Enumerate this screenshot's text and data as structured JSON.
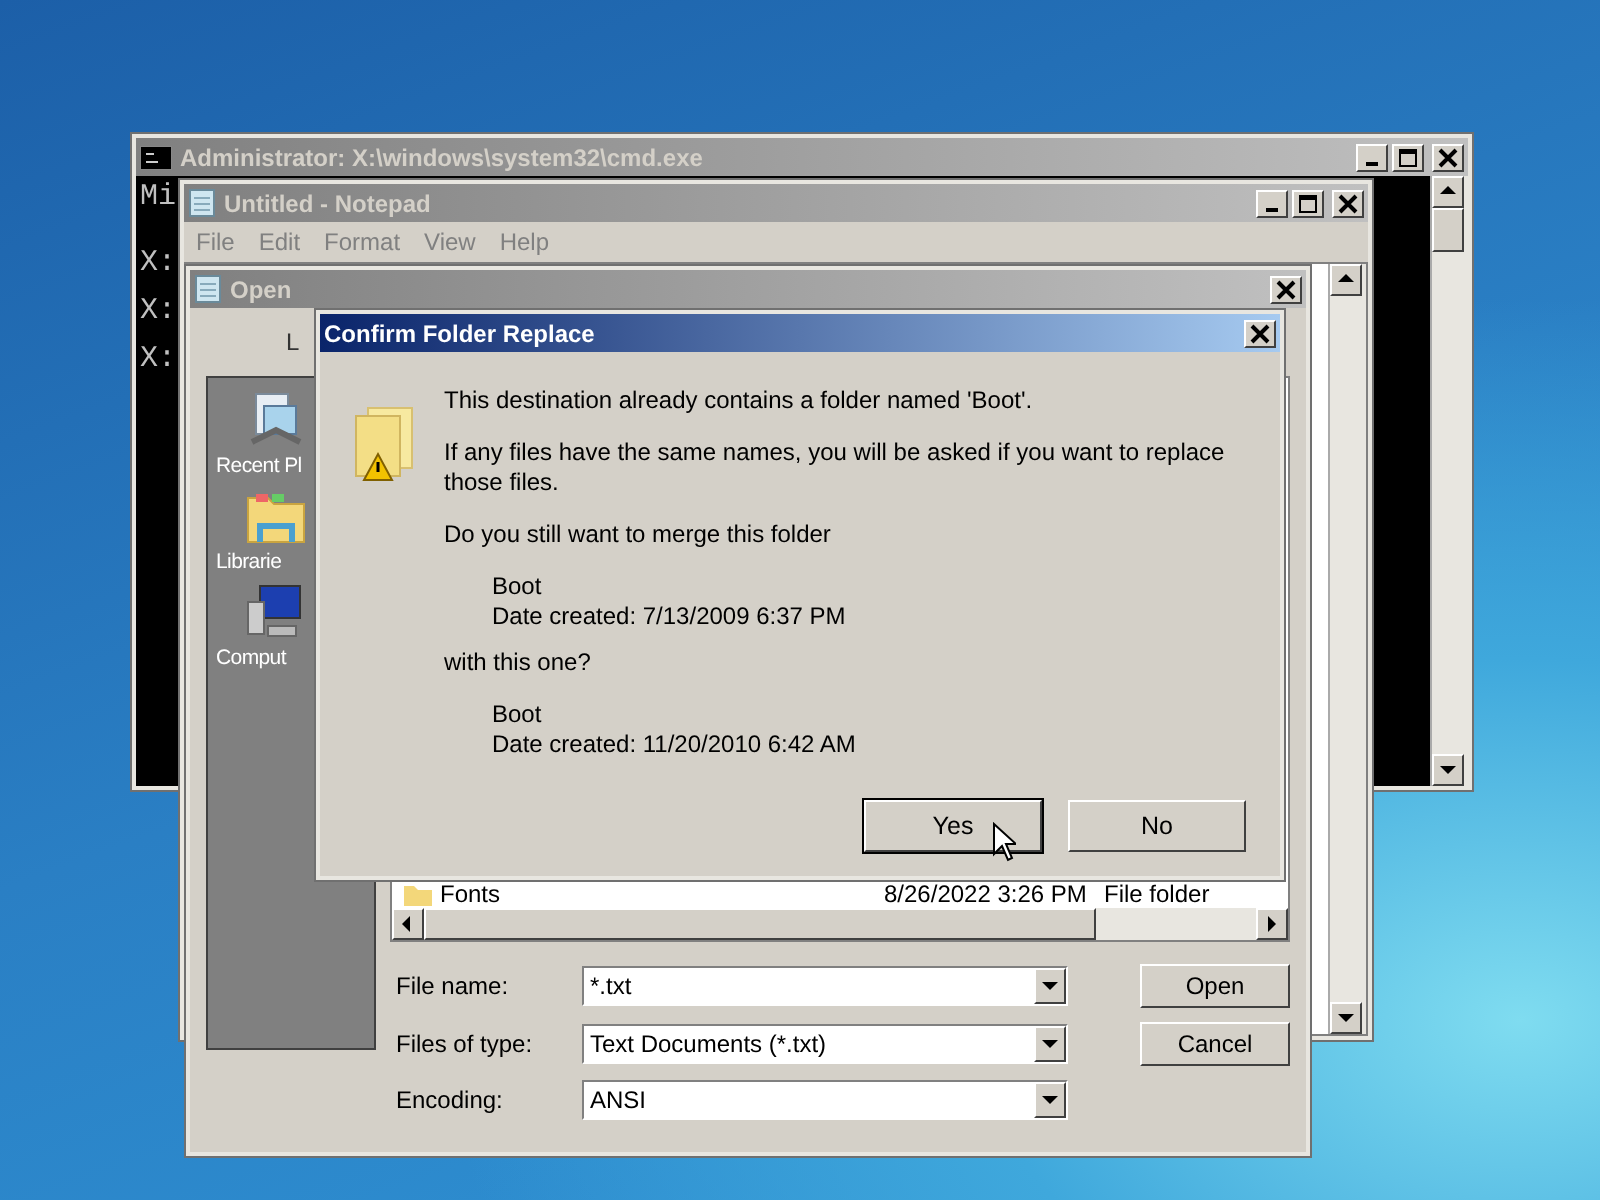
{
  "console_window": {
    "title": "Administrator: X:\\windows\\system32\\cmd.exe",
    "lines": [
      "Mi",
      "X:",
      "X:",
      "X:"
    ]
  },
  "notepad_window": {
    "title": "Untitled - Notepad",
    "menu": [
      "File",
      "Edit",
      "Format",
      "View",
      "Help"
    ]
  },
  "open_dialog": {
    "title": "Open",
    "look_in_label": "L",
    "places": [
      {
        "label": "Recent Pl",
        "kind": "recent"
      },
      {
        "label": "Librarie",
        "kind": "libraries"
      },
      {
        "label": "Comput",
        "kind": "computer"
      }
    ],
    "files": [
      {
        "name": "Fonts",
        "date_modified": "8/26/2022 3:26 PM",
        "type": "File folder"
      }
    ],
    "fields": [
      {
        "label": "File name:",
        "value": "*.txt"
      },
      {
        "label": "Files of type:",
        "value": "Text Documents (*.txt)"
      },
      {
        "label": "Encoding:",
        "value": "ANSI"
      }
    ],
    "buttons": [
      "Open",
      "Cancel"
    ]
  },
  "confirm_dialog": {
    "title": "Confirm Folder Replace",
    "message": "This destination already contains a folder named 'Boot'.",
    "detail": "If any files have the same names, you will be asked if you want to replace those files.",
    "question": "Do you still want to merge this folder",
    "existing": {
      "name": "Boot",
      "date": "Date created: 7/13/2009 6:37 PM"
    },
    "connector": "with this one?",
    "incoming": {
      "name": "Boot",
      "date": "Date created: 11/20/2010 6:42 AM"
    },
    "buttons": [
      {
        "label": "Yes",
        "focused": true
      },
      {
        "label": "No",
        "focused": false
      }
    ]
  }
}
